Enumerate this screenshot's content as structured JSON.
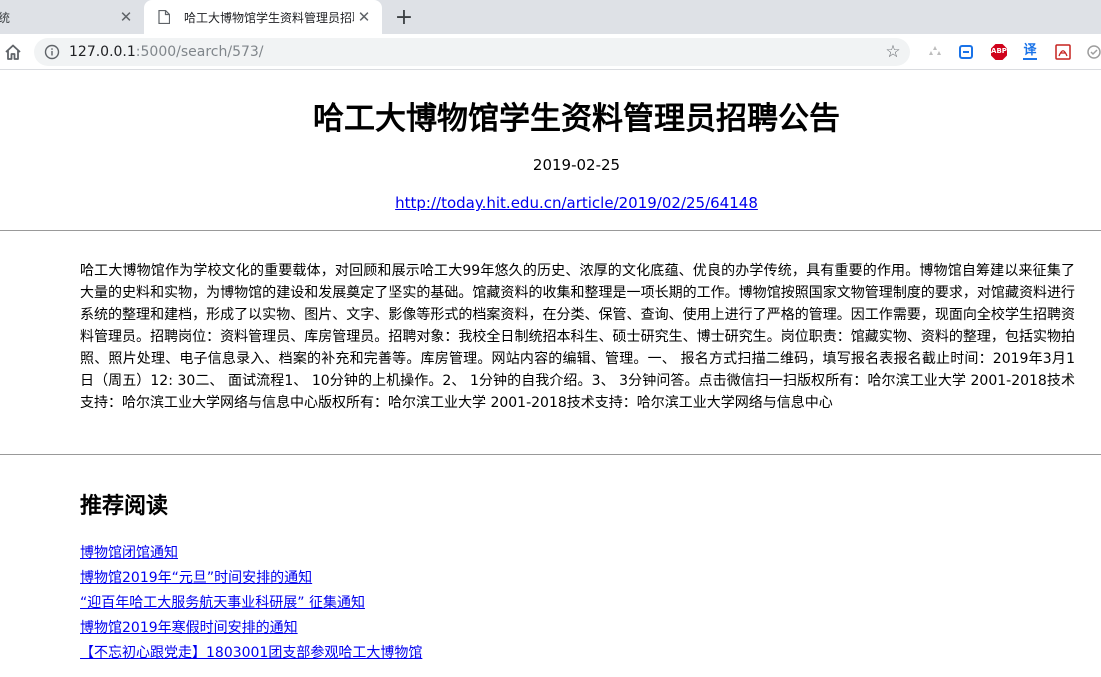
{
  "browser": {
    "tabs": [
      {
        "title": "统",
        "active": false
      },
      {
        "title": "哈工大博物馆学生资料管理员招聘",
        "active": true
      }
    ],
    "url": {
      "host": "127.0.0.1",
      "path": ":5000/search/573/"
    },
    "icons": {
      "new_tab": "plus-icon",
      "home": "home-icon",
      "info": "info-icon",
      "bookmark": "star-icon",
      "extensions": [
        "puzzle-icon",
        "refresh-ext-icon",
        "adblock-icon",
        "translate-icon",
        "pdf-icon",
        "shield-ext-icon"
      ]
    },
    "ext_labels": {
      "adblock": "ABP",
      "translate": "译"
    }
  },
  "article": {
    "title": "哈工大博物馆学生资料管理员招聘公告",
    "date": "2019-02-25",
    "link": "http://today.hit.edu.cn/article/2019/02/25/64148",
    "body": "哈工大博物馆作为学校文化的重要载体，对回顾和展示哈工大99年悠久的历史、浓厚的文化底蕴、优良的办学传统，具有重要的作用。博物馆自筹建以来征集了大量的史料和实物，为博物馆的建设和发展奠定了坚实的基础。馆藏资料的收集和整理是一项长期的工作。博物馆按照国家文物管理制度的要求，对馆藏资料进行系统的整理和建档，形成了以实物、图片、文字、影像等形式的档案资料，在分类、保管、查询、使用上进行了严格的管理。因工作需要，现面向全校学生招聘资料管理员。招聘岗位：资料管理员、库房管理员。招聘对象：我校全日制统招本科生、硕士研究生、博士研究生。岗位职责：馆藏实物、资料的整理，包括实物拍照、照片处理、电子信息录入、档案的补充和完善等。库房管理。网站内容的编辑、管理。一、 报名方式扫描二维码，填写报名表报名截止时间：2019年3月1日（周五）12: 30二、 面试流程1、 10分钟的上机操作。2、 1分钟的自我介绍。3、 3分钟问答。点击微信扫一扫版权所有：哈尔滨工业大学 2001-2018技术支持：哈尔滨工业大学网络与信息中心版权所有：哈尔滨工业大学 2001-2018技术支持：哈尔滨工业大学网络与信息中心"
  },
  "recommended": {
    "heading": "推荐阅读",
    "items": [
      "博物馆闭馆通知",
      "博物馆2019年“元旦”时间安排的通知",
      "“迎百年哈工大服务航天事业科研展” 征集通知",
      "博物馆2019年寒假时间安排的通知",
      "【不忘初心跟党走】1803001团支部参观哈工大博物馆"
    ]
  }
}
